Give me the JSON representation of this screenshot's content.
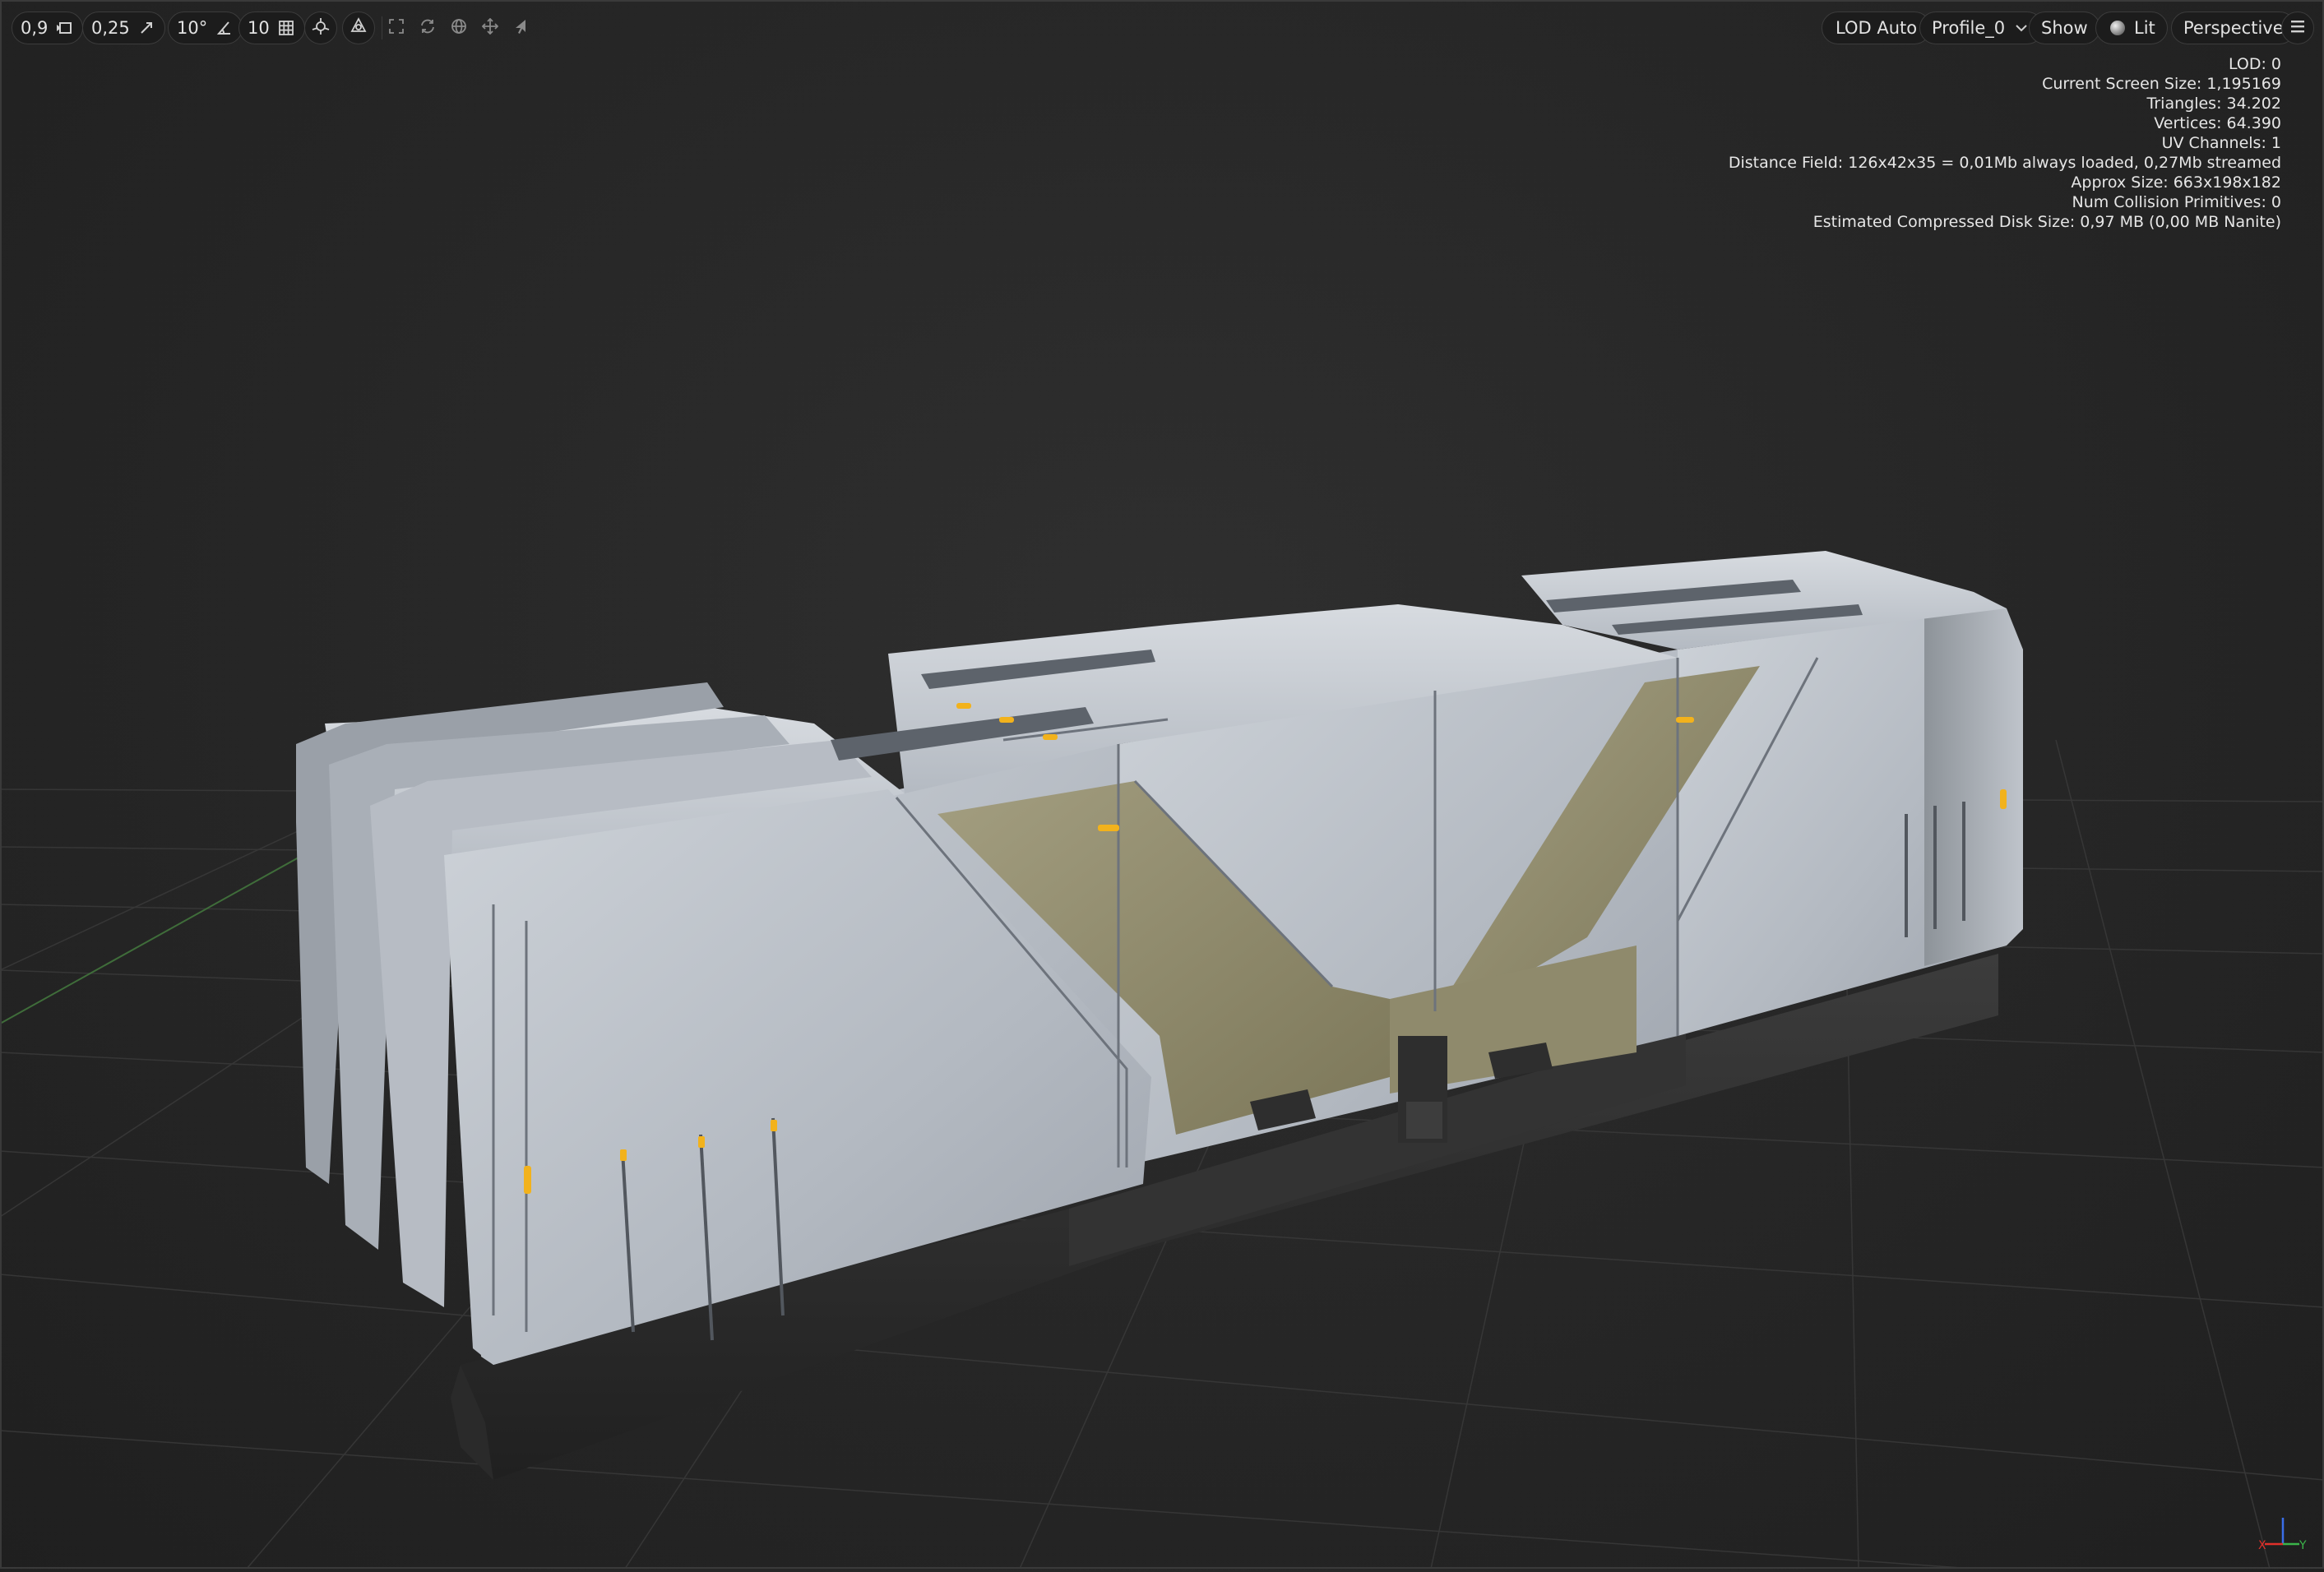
{
  "toolbar": {
    "menu_icon": "hamburger-icon",
    "perspective_label": "Perspective",
    "lit_label": "Lit",
    "show_label": "Show",
    "profile_label": "Profile_0",
    "lod_label": "LOD Auto",
    "snap": {
      "camera_speed": "0,9",
      "scale_snap": "0,25",
      "rotation_snap": "10°",
      "grid_snap": "10"
    }
  },
  "stats": {
    "lines": [
      "LOD:  0",
      "Current Screen Size:  1,195169",
      "Triangles:  34.202",
      "Vertices:  64.390",
      "UV Channels:  1",
      "Distance Field:  126x42x35 = 0,01Mb always loaded, 0,27Mb streamed",
      "Approx Size: 663x198x182",
      "Num Collision Primitives:  0",
      "Estimated Compressed Disk Size: 0,97 MB (0,00 MB Nanite)"
    ]
  },
  "axes": {
    "x_label": "X",
    "y_label": "Y",
    "x_color": "#e0302a",
    "y_color": "#3bb54a",
    "z_color": "#3a6ee8"
  },
  "colors": {
    "background": "#262626",
    "accent": "#f2b21c",
    "panel": "#b9bec6",
    "olive": "#8b8668"
  }
}
